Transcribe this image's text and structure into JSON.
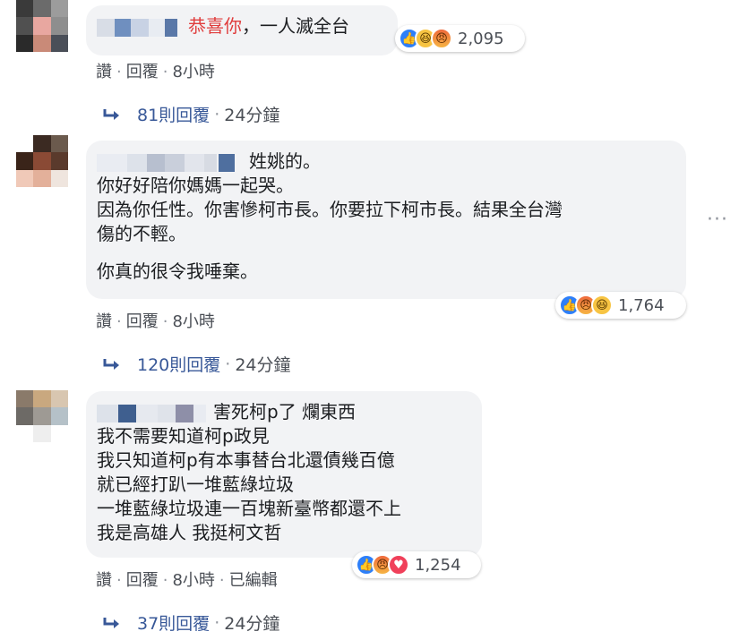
{
  "comments": [
    {
      "lines": [
        "恭喜你，一人滅全台"
      ],
      "red_prefix": "恭喜你",
      "rest": "，一人滅全台",
      "reactions": [
        "like",
        "haha",
        "angry"
      ],
      "reaction_count": "2,095",
      "meta": {
        "like": "讚",
        "reply": "回覆",
        "time": "8小時"
      },
      "replies": {
        "count": "81則回覆",
        "time": "24分鐘"
      }
    },
    {
      "name_suffix": "姓姚的。",
      "lines": [
        "你好好陪你媽媽一起哭。",
        "因為你任性。你害慘柯市長。你要拉下柯市長。結果全台灣",
        "傷的不輕。",
        "你真的很令我唾棄。"
      ],
      "reactions": [
        "like",
        "angry",
        "haha"
      ],
      "reaction_count": "1,764",
      "meta": {
        "like": "讚",
        "reply": "回覆",
        "time": "8小時"
      },
      "replies": {
        "count": "120則回覆",
        "time": "24分鐘"
      }
    },
    {
      "name_suffix": "害死柯p了 爛東西",
      "lines": [
        "我不需要知道柯p政見",
        "我只知道柯p有本事替台北還債幾百億",
        "就已經打趴一堆藍綠垃圾",
        "一堆藍綠垃圾連一百塊新臺幣都還不上",
        "我是高雄人 我挺柯文哲"
      ],
      "reactions": [
        "like",
        "angry",
        "love"
      ],
      "reaction_count": "1,254",
      "meta": {
        "like": "讚",
        "reply": "回覆",
        "time": "8小時",
        "edited": "已編輯"
      },
      "replies": {
        "count": "37則回覆",
        "time": "24分鐘"
      }
    }
  ],
  "colors": {
    "bubble": "#f2f3f5",
    "accent": "#385898",
    "red": "#e03c3c"
  }
}
